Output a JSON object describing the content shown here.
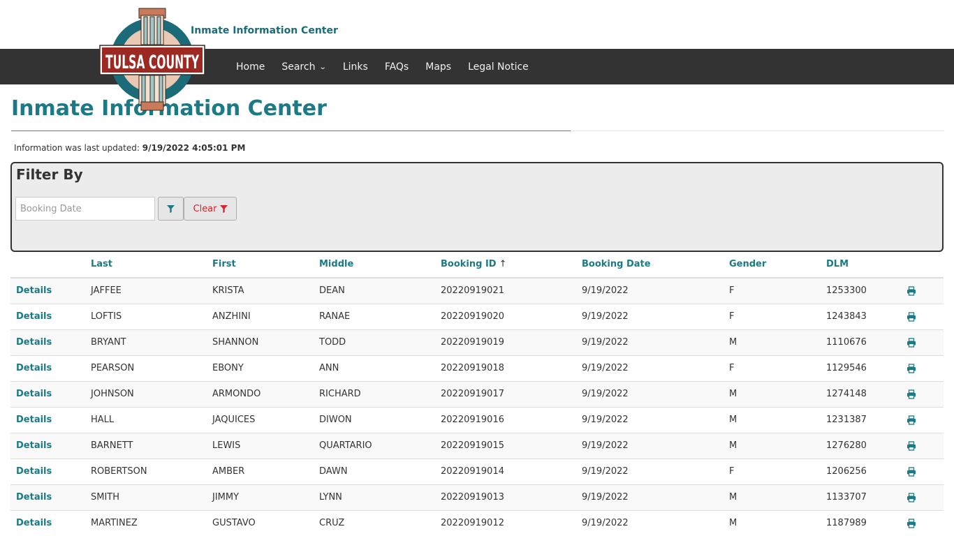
{
  "header": {
    "site_title": "Inmate Information Center",
    "logo_text": "TULSA COUNTY"
  },
  "nav": {
    "items": [
      {
        "label": "Home"
      },
      {
        "label": "Search",
        "has_dropdown": true
      },
      {
        "label": "Links"
      },
      {
        "label": "FAQs"
      },
      {
        "label": "Maps"
      },
      {
        "label": "Legal Notice"
      }
    ]
  },
  "page": {
    "title": "Inmate Information Center",
    "updated_prefix": "Information was last updated:",
    "updated_value": "9/19/2022 4:05:01 PM"
  },
  "filter": {
    "title": "Filter By",
    "booking_date_placeholder": "Booking Date",
    "booking_date_value": "",
    "clear_label": "Clear"
  },
  "table": {
    "columns": [
      "",
      "Last",
      "First",
      "Middle",
      "Booking ID",
      "Booking Date",
      "Gender",
      "DLM",
      ""
    ],
    "sorted_column": "Booking ID",
    "sort_direction": "ascending",
    "details_label": "Details",
    "rows": [
      {
        "last": "JAFFEE",
        "first": "KRISTA",
        "middle": "DEAN",
        "booking_id": "20220919021",
        "booking_date": "9/19/2022",
        "gender": "F",
        "dlm": "1253300"
      },
      {
        "last": "LOFTIS",
        "first": "ANZHINI",
        "middle": "RANAE",
        "booking_id": "20220919020",
        "booking_date": "9/19/2022",
        "gender": "F",
        "dlm": "1243843"
      },
      {
        "last": "BRYANT",
        "first": "SHANNON",
        "middle": "TODD",
        "booking_id": "20220919019",
        "booking_date": "9/19/2022",
        "gender": "M",
        "dlm": "1110676"
      },
      {
        "last": "PEARSON",
        "first": "EBONY",
        "middle": "ANN",
        "booking_id": "20220919018",
        "booking_date": "9/19/2022",
        "gender": "F",
        "dlm": "1129546"
      },
      {
        "last": "JOHNSON",
        "first": "ARMONDO",
        "middle": "RICHARD",
        "booking_id": "20220919017",
        "booking_date": "9/19/2022",
        "gender": "M",
        "dlm": "1274148"
      },
      {
        "last": "HALL",
        "first": "JAQUICES",
        "middle": "DIWON",
        "booking_id": "20220919016",
        "booking_date": "9/19/2022",
        "gender": "M",
        "dlm": "1231387"
      },
      {
        "last": "BARNETT",
        "first": "LEWIS",
        "middle": "QUARTARIO",
        "booking_id": "20220919015",
        "booking_date": "9/19/2022",
        "gender": "M",
        "dlm": "1276280"
      },
      {
        "last": "ROBERTSON",
        "first": "AMBER",
        "middle": "DAWN",
        "booking_id": "20220919014",
        "booking_date": "9/19/2022",
        "gender": "F",
        "dlm": "1206256"
      },
      {
        "last": "SMITH",
        "first": "JIMMY",
        "middle": "LYNN",
        "booking_id": "20220919013",
        "booking_date": "9/19/2022",
        "gender": "M",
        "dlm": "1133707"
      },
      {
        "last": "MARTINEZ",
        "first": "GUSTAVO",
        "middle": "CRUZ",
        "booking_id": "20220919012",
        "booking_date": "9/19/2022",
        "gender": "M",
        "dlm": "1187989"
      }
    ]
  },
  "colors": {
    "accent": "#1b7a86",
    "navbar": "#333333",
    "title_rule": "#b85c2e",
    "clear_red": "#d9232d",
    "logo_red": "#9c2a23"
  },
  "icons": {
    "filter": "filter-icon",
    "clear": "filter-icon",
    "print": "print-icon",
    "sort": "arrow-up-icon",
    "dropdown": "chevron-down-icon"
  }
}
